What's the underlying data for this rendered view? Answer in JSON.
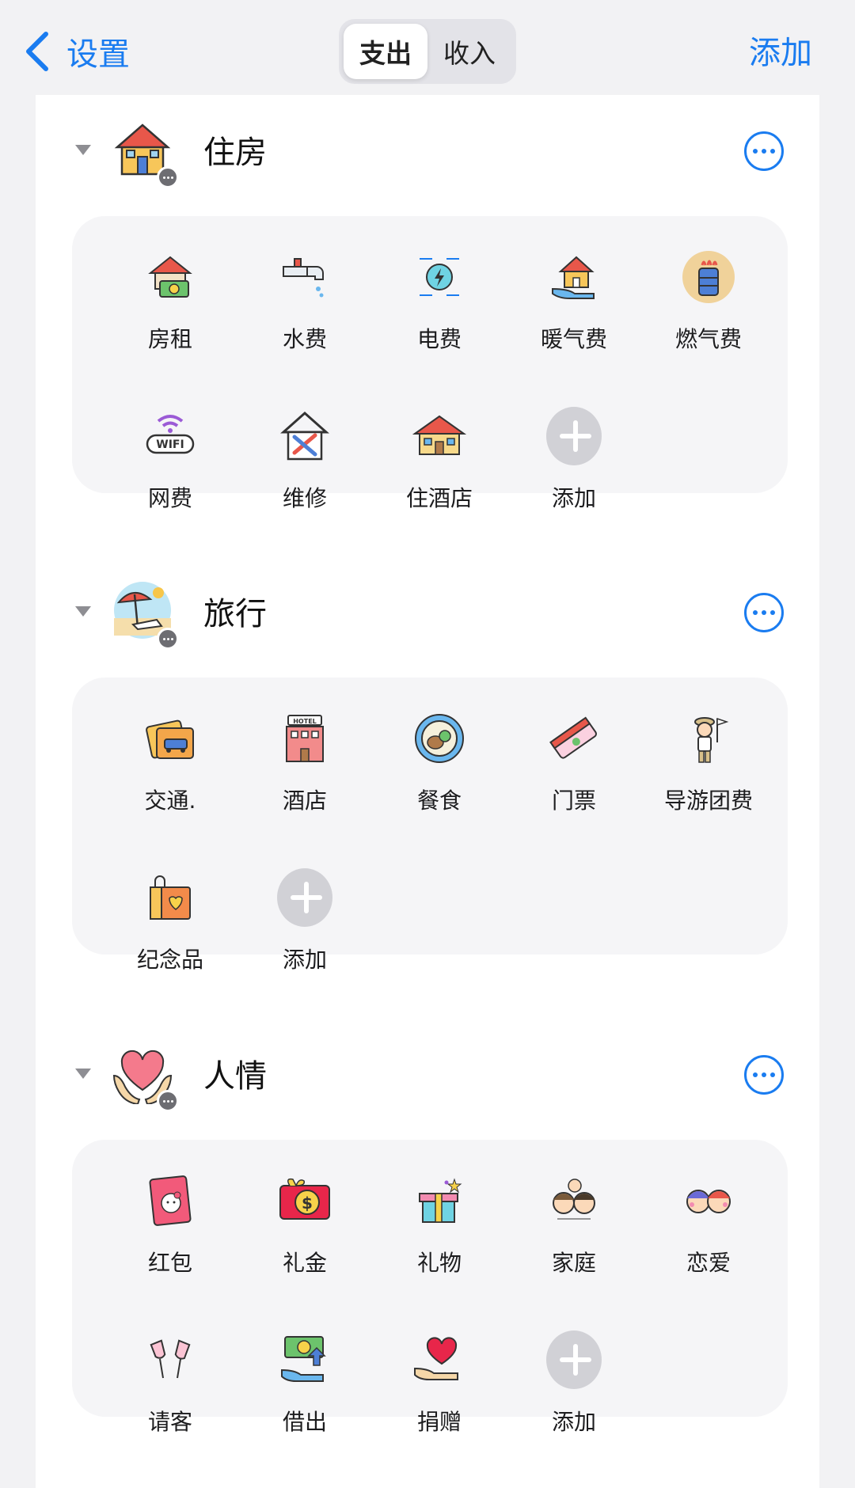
{
  "nav": {
    "back_label": "设置",
    "segments": [
      {
        "label": "支出",
        "active": true
      },
      {
        "label": "收入",
        "active": false
      }
    ],
    "add_label": "添加"
  },
  "accent_color": "#1a7cf0",
  "sections": [
    {
      "title": "住房",
      "icon": "house-icon",
      "items": [
        {
          "label": "房租",
          "icon": "rent-house-money-icon"
        },
        {
          "label": "水费",
          "icon": "water-tap-icon"
        },
        {
          "label": "电费",
          "icon": "electricity-icon"
        },
        {
          "label": "暖气费",
          "icon": "heating-house-hand-icon"
        },
        {
          "label": "燃气费",
          "icon": "gas-tank-icon"
        },
        {
          "label": "网费",
          "icon": "wifi-icon"
        },
        {
          "label": "维修",
          "icon": "repair-tools-icon"
        },
        {
          "label": "住酒店",
          "icon": "hotel-house-icon"
        },
        {
          "label": "添加",
          "icon": "add-icon"
        }
      ]
    },
    {
      "title": "旅行",
      "icon": "beach-icon",
      "items": [
        {
          "label": "交通.",
          "icon": "car-ticket-icon"
        },
        {
          "label": "酒店",
          "icon": "hotel-building-icon"
        },
        {
          "label": "餐食",
          "icon": "food-plate-icon"
        },
        {
          "label": "门票",
          "icon": "ticket-icon"
        },
        {
          "label": "导游团费",
          "icon": "tour-guide-icon"
        },
        {
          "label": "纪念品",
          "icon": "souvenir-bag-icon"
        },
        {
          "label": "添加",
          "icon": "add-icon"
        }
      ]
    },
    {
      "title": "人情",
      "icon": "heart-hands-icon",
      "items": [
        {
          "label": "红包",
          "icon": "red-envelope-icon"
        },
        {
          "label": "礼金",
          "icon": "cash-gift-icon"
        },
        {
          "label": "礼物",
          "icon": "gift-box-icon"
        },
        {
          "label": "家庭",
          "icon": "family-icon"
        },
        {
          "label": "恋爱",
          "icon": "couple-icon"
        },
        {
          "label": "请客",
          "icon": "champagne-toast-icon"
        },
        {
          "label": "借出",
          "icon": "lend-money-icon"
        },
        {
          "label": "捐赠",
          "icon": "donate-heart-icon"
        },
        {
          "label": "添加",
          "icon": "add-icon"
        }
      ]
    }
  ]
}
